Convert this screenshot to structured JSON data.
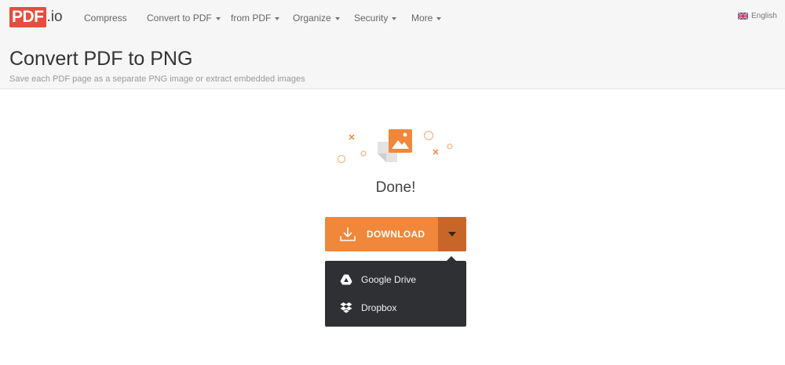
{
  "logo": {
    "brand": "PDF",
    "ext": ".io"
  },
  "nav": {
    "compress": "Compress",
    "convert_to_pdf": "Convert to PDF",
    "from_pdf": "from PDF",
    "organize": "Organize",
    "security": "Security",
    "more": "More"
  },
  "language": {
    "label": "English",
    "flag_icon": "uk-flag-icon"
  },
  "page": {
    "title": "Convert PDF to PNG",
    "subtitle": "Save each PDF page as a separate PNG image or extract embedded images"
  },
  "status": {
    "text": "Done!"
  },
  "download": {
    "label": "DOWNLOAD"
  },
  "menu": {
    "google_drive": "Google Drive",
    "dropbox": "Dropbox"
  },
  "colors": {
    "brand_red": "#e84c3d",
    "accent_orange": "#f0873a",
    "accent_orange_dark": "#c8662a",
    "menu_bg": "#2f3033"
  },
  "icons": {
    "image": "image-icon",
    "download": "download-icon",
    "google_drive": "google-drive-icon",
    "dropbox": "dropbox-icon"
  }
}
